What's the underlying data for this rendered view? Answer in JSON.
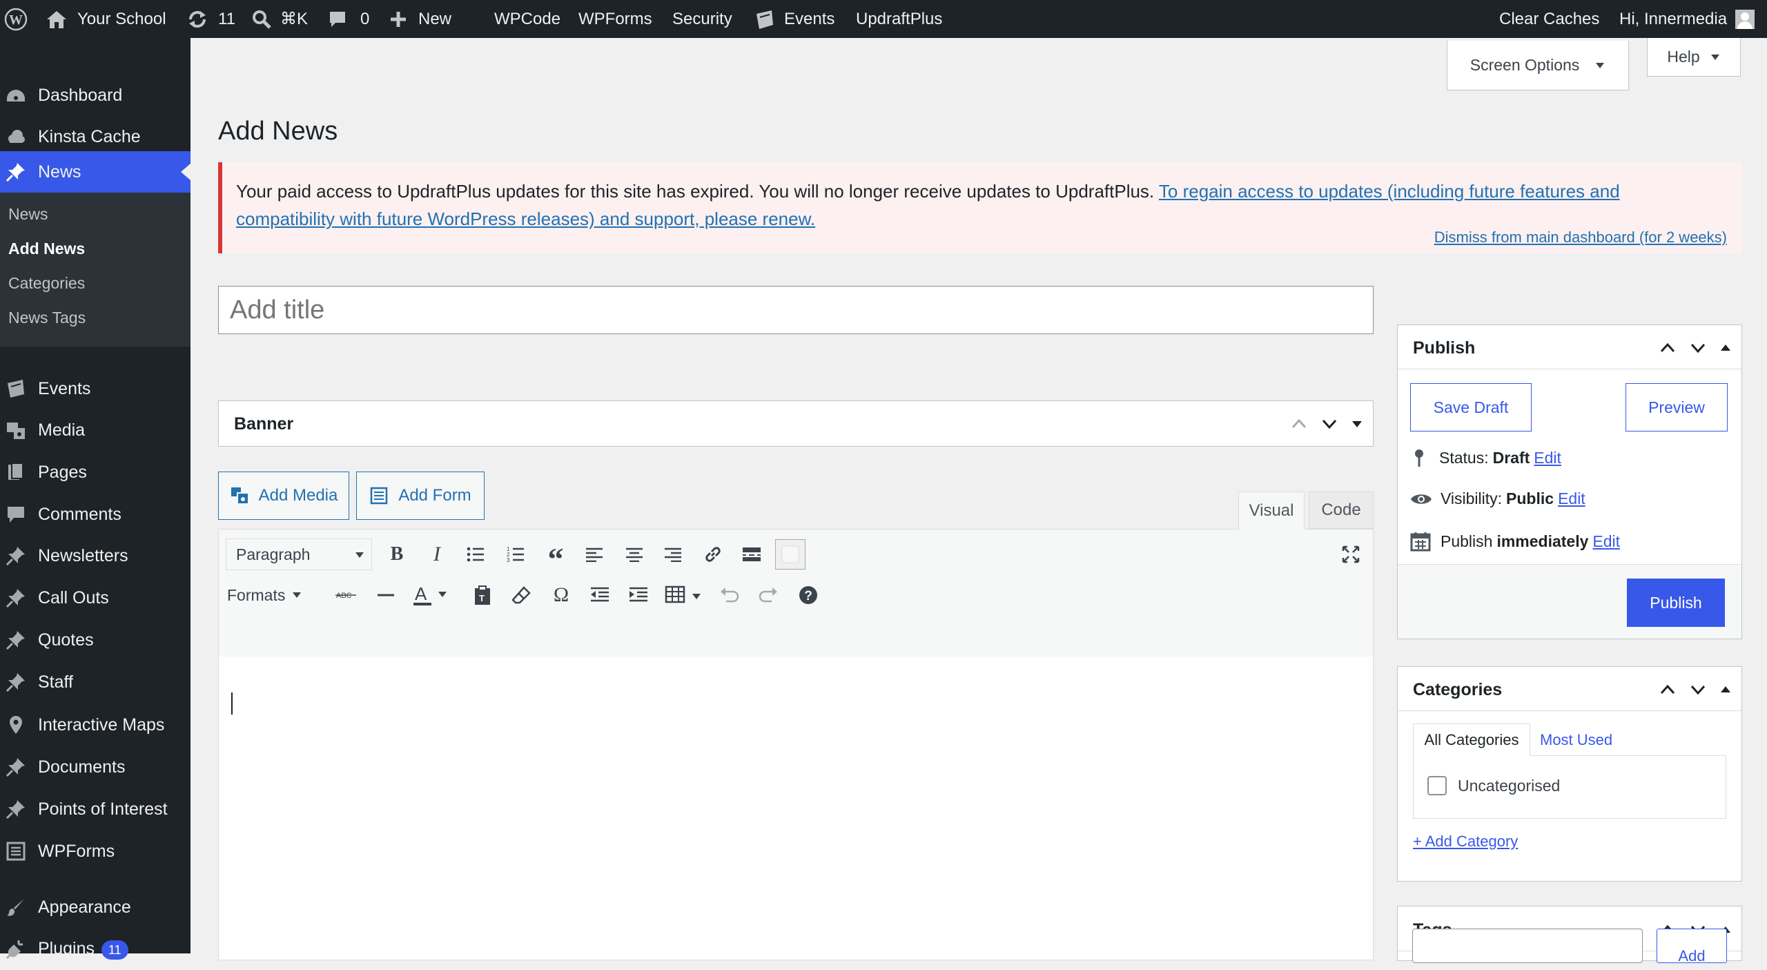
{
  "adminbar": {
    "site_name": "Your School",
    "updates_count": "11",
    "shortcut": "⌘K",
    "comments_count": "0",
    "new_label": "New",
    "items": [
      "WPCode",
      "WPForms",
      "Security",
      "Events",
      "UpdraftPlus"
    ],
    "clear_caches": "Clear Caches",
    "greeting": "Hi, Innermedia"
  },
  "sidebar": {
    "dashboard": "Dashboard",
    "kinsta": "Kinsta Cache",
    "news": "News",
    "submenu": [
      "News",
      "Add News",
      "Categories",
      "News Tags"
    ],
    "events": "Events",
    "media": "Media",
    "pages": "Pages",
    "comments": "Comments",
    "newsletters": "Newsletters",
    "callouts": "Call Outs",
    "quotes": "Quotes",
    "staff": "Staff",
    "maps": "Interactive Maps",
    "documents": "Documents",
    "poi": "Points of Interest",
    "wpforms": "WPForms",
    "appearance": "Appearance",
    "plugins": "Plugins",
    "plugins_badge": "11"
  },
  "screen_options": "Screen Options",
  "help": "Help",
  "page_title": "Add News",
  "notice": {
    "text": "Your paid access to UpdraftPlus updates for this site has expired. You will no longer receive updates to UpdraftPlus. ",
    "link1": "To regain access to updates (including future features and",
    "link2": "compatibility with future WordPress releases) and support, please renew.",
    "dismiss": "Dismiss from main dashboard (for 2 weeks)"
  },
  "title_placeholder": "Add title",
  "banner_title": "Banner",
  "editor": {
    "add_media": "Add Media",
    "add_form": "Add Form",
    "tab_visual": "Visual",
    "tab_code": "Code",
    "format_select": "Paragraph",
    "formats": "Formats"
  },
  "publish": {
    "title": "Publish",
    "save_draft": "Save Draft",
    "preview": "Preview",
    "status_label": "Status: ",
    "status_value": "Draft",
    "visibility_label": "Visibility: ",
    "visibility_value": "Public",
    "publish_label": "Publish ",
    "publish_value": "immediately",
    "edit": "Edit",
    "publish_button": "Publish"
  },
  "categories": {
    "title": "Categories",
    "tab_all": "All Categories",
    "tab_most": "Most Used",
    "item": "Uncategorised",
    "add": "+ Add Category"
  },
  "tags": {
    "title": "Tags",
    "add_button": "Add"
  },
  "colors": {
    "adminbar": "#1d2327",
    "accent": "#3858e9",
    "link": "#2271b1",
    "notice_border": "#d63638",
    "notice_bg": "#fcf0f1"
  }
}
